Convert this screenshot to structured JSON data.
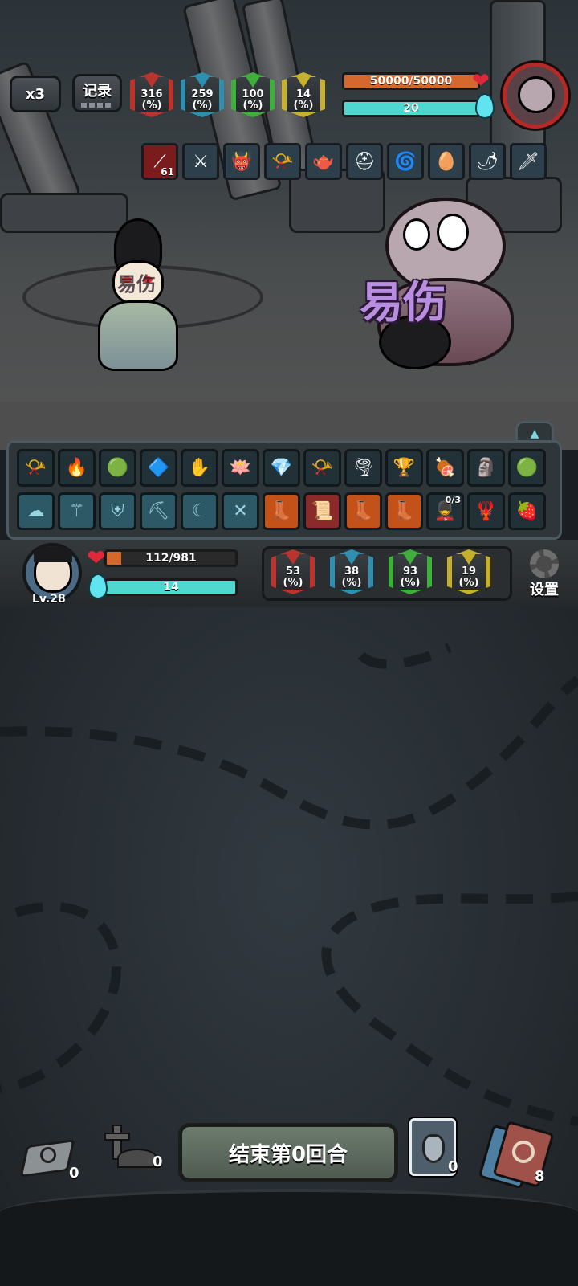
{
  "top_bar": {
    "speed_label": "x3",
    "record_label": "记录"
  },
  "enemy_stats": [
    {
      "name": "attack",
      "value": "316",
      "unit": "(%)",
      "color": "#b8342c"
    },
    {
      "name": "crit",
      "value": "259",
      "unit": "(%)",
      "color": "#2f8fb0"
    },
    {
      "name": "defense",
      "value": "100",
      "unit": "(%)",
      "color": "#3fae3c"
    },
    {
      "name": "speed",
      "value": "14",
      "unit": "(%)",
      "color": "#c7b12c"
    }
  ],
  "enemy": {
    "hp_text": "50000/50000",
    "hp_fraction": 1.0,
    "energy_text": "20",
    "energy_fraction": 1.0,
    "status_label": "易伤",
    "avatar_icon": "zombie-icon"
  },
  "enemy_items": [
    {
      "icon": "claw-slash-icon",
      "count": "61"
    },
    {
      "icon": "spears-icon",
      "count": ""
    },
    {
      "icon": "red-demon-icon",
      "count": ""
    },
    {
      "icon": "golden-horn-icon",
      "count": ""
    },
    {
      "icon": "teapot-icon",
      "count": ""
    },
    {
      "icon": "helmet-icon",
      "count": ""
    },
    {
      "icon": "galaxy-plate-icon",
      "count": ""
    },
    {
      "icon": "egg-icon",
      "count": ""
    },
    {
      "icon": "chili-icon",
      "count": ""
    },
    {
      "icon": "poison-dagger-icon",
      "count": ""
    }
  ],
  "player_character": {
    "status_label": "易伤"
  },
  "inventory_row1": [
    {
      "icon": "golden-horn-icon"
    },
    {
      "icon": "fire-pot-icon"
    },
    {
      "icon": "green-jade-icon"
    },
    {
      "icon": "blue-horn-icon"
    },
    {
      "icon": "bandage-hand-icon"
    },
    {
      "icon": "lotus-fire-icon"
    },
    {
      "icon": "crystals-icon"
    },
    {
      "icon": "golden-horn-icon"
    },
    {
      "icon": "vortex-icon"
    },
    {
      "icon": "flame-cup-icon"
    },
    {
      "icon": "meat-icon"
    },
    {
      "icon": "stone-mask-icon"
    },
    {
      "icon": "green-jade-icon"
    }
  ],
  "inventory_row2": [
    {
      "icon": "ghost-cloud-icon",
      "style": "ghost",
      "count": ""
    },
    {
      "icon": "ghost-staff-icon",
      "style": "ghost",
      "count": ""
    },
    {
      "icon": "ghost-armor-icon",
      "style": "ghost",
      "count": ""
    },
    {
      "icon": "ghost-pick-icon",
      "style": "ghost",
      "count": ""
    },
    {
      "icon": "ghost-moon-icon",
      "style": "ghost",
      "count": ""
    },
    {
      "icon": "ghost-cross-icon",
      "style": "ghost",
      "count": ""
    },
    {
      "icon": "fire-boot-icon",
      "style": "fire",
      "count": ""
    },
    {
      "icon": "red-scroll-icon",
      "style": "red",
      "count": ""
    },
    {
      "icon": "fire-boot-icon",
      "style": "fire",
      "count": ""
    },
    {
      "icon": "fire-boot-icon",
      "style": "fire",
      "count": ""
    },
    {
      "icon": "soldier-icon",
      "style": "",
      "count": "0/3"
    },
    {
      "icon": "red-beast-icon",
      "style": "",
      "count": ""
    },
    {
      "icon": "strawberry-icon",
      "style": "",
      "count": ""
    }
  ],
  "player": {
    "level": "Lv.28",
    "hp_text": "112/981",
    "hp_fraction": 0.114,
    "energy_text": "14",
    "energy_fraction": 1.0,
    "avatar_icon": "heroine-face-icon"
  },
  "player_stats": [
    {
      "name": "attack",
      "value": "53",
      "unit": "(%)",
      "color": "#b8342c"
    },
    {
      "name": "crit",
      "value": "38",
      "unit": "(%)",
      "color": "#2f8fb0"
    },
    {
      "name": "defense",
      "value": "93",
      "unit": "(%)",
      "color": "#3fae3c"
    },
    {
      "name": "speed",
      "value": "19",
      "unit": "(%)",
      "color": "#c7b12c"
    }
  ],
  "settings_label": "设置",
  "bottom": {
    "draw_pile_count": "0",
    "grave_count": "0",
    "end_turn_label": "结束第0回合",
    "potion_count": "0",
    "deck_count": "8"
  }
}
